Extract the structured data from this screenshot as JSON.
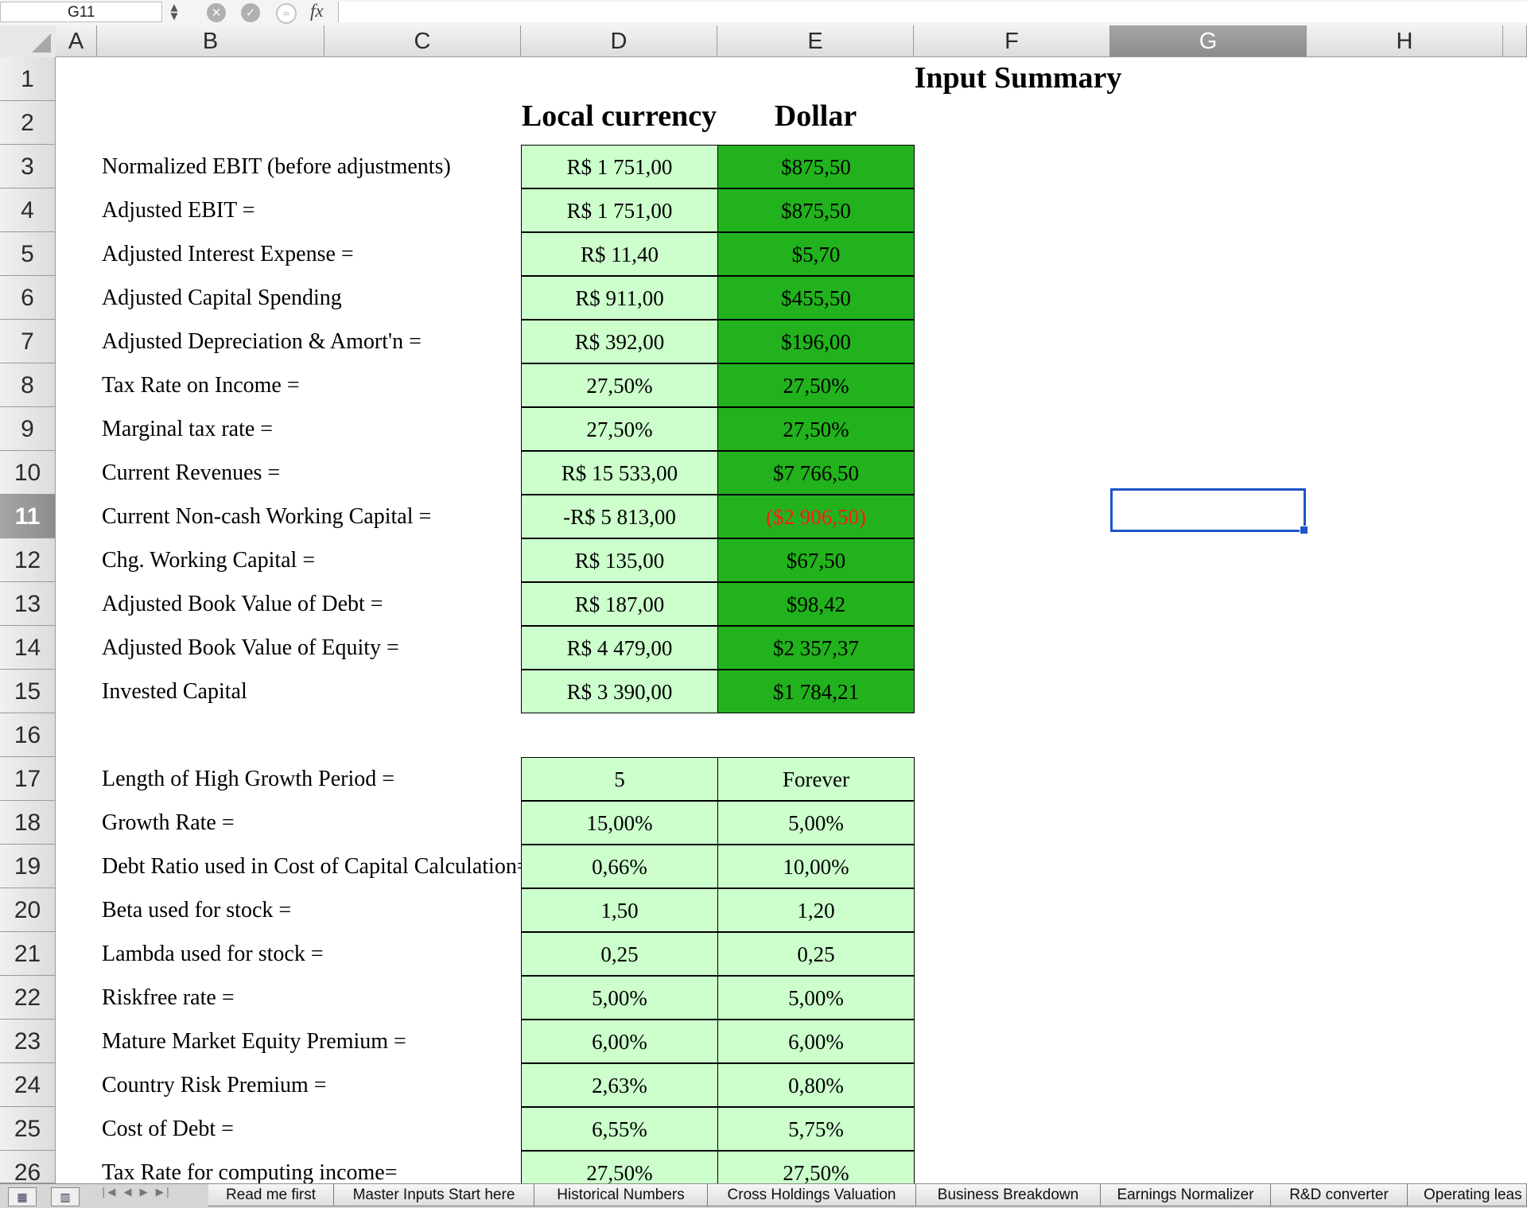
{
  "formula_bar": {
    "name_box": "G11",
    "fx_label": "fx",
    "formula": ""
  },
  "columns": [
    "A",
    "B",
    "C",
    "D",
    "E",
    "F",
    "G",
    "H"
  ],
  "active_column": "G",
  "active_row": "11",
  "rows": [
    "1",
    "2",
    "3",
    "4",
    "5",
    "6",
    "7",
    "8",
    "9",
    "10",
    "11",
    "12",
    "13",
    "14",
    "15",
    "16",
    "17",
    "18",
    "19",
    "20",
    "21",
    "22",
    "23",
    "24",
    "25",
    "26"
  ],
  "sheet": {
    "title": "Input Summary",
    "header_local": "Local currency",
    "header_dollar": "Dollar",
    "block1": [
      {
        "label": "Normalized EBIT (before adjustments)",
        "local": "R$ 1 751,00",
        "dollar": "$875,50"
      },
      {
        "label": "Adjusted EBIT =",
        "local": "R$ 1 751,00",
        "dollar": "$875,50"
      },
      {
        "label": "Adjusted Interest Expense =",
        "local": "R$ 11,40",
        "dollar": "$5,70"
      },
      {
        "label": "Adjusted Capital Spending",
        "local": "R$ 911,00",
        "dollar": "$455,50"
      },
      {
        "label": "Adjusted Depreciation & Amort'n =",
        "local": "R$ 392,00",
        "dollar": "$196,00"
      },
      {
        "label": "Tax Rate on Income =",
        "local": "27,50%",
        "dollar": "27,50%"
      },
      {
        "label": "Marginal tax rate =",
        "local": "27,50%",
        "dollar": "27,50%"
      },
      {
        "label": "Current Revenues =",
        "local": "R$ 15 533,00",
        "dollar": "$7 766,50"
      },
      {
        "label": "Current Non-cash Working Capital =",
        "local": "-R$ 5 813,00",
        "dollar": "($2 906,50)",
        "negative": true
      },
      {
        "label": "Chg. Working Capital =",
        "local": "R$ 135,00",
        "dollar": "$67,50"
      },
      {
        "label": "Adjusted Book Value of Debt =",
        "local": "R$ 187,00",
        "dollar": "$98,42"
      },
      {
        "label": "Adjusted Book Value of Equity =",
        "local": "R$ 4 479,00",
        "dollar": "$2 357,37"
      },
      {
        "label": "Invested Capital",
        "local": "R$ 3 390,00",
        "dollar": "$1 784,21"
      }
    ],
    "block2": [
      {
        "label": "Length of High Growth Period =",
        "local": "5",
        "dollar": "Forever"
      },
      {
        "label": "Growth Rate =",
        "local": "15,00%",
        "dollar": "5,00%"
      },
      {
        "label": "Debt Ratio used in Cost of Capital Calculation=",
        "local": "0,66%",
        "dollar": "10,00%"
      },
      {
        "label": "Beta used for stock =",
        "local": "1,50",
        "dollar": "1,20"
      },
      {
        "label": "Lambda used for stock =",
        "local": "0,25",
        "dollar": "0,25"
      },
      {
        "label": "Riskfree rate =",
        "local": "5,00%",
        "dollar": "5,00%"
      },
      {
        "label": "Mature Market Equity Premium =",
        "local": "6,00%",
        "dollar": "6,00%"
      },
      {
        "label": "Country Risk Premium =",
        "local": "2,63%",
        "dollar": "0,80%"
      },
      {
        "label": "Cost of Debt =",
        "local": "6,55%",
        "dollar": "5,75%"
      },
      {
        "label": "Tax Rate for computing income=",
        "local": "27,50%",
        "dollar": "27,50%"
      }
    ]
  },
  "tabs": [
    "Read me first",
    "Master Inputs Start here",
    "Historical Numbers",
    "Cross Holdings Valuation",
    "Business Breakdown",
    "Earnings Normalizer",
    "R&D converter",
    "Operating leas"
  ],
  "colors": {
    "light_green": "#ccffcc",
    "dark_green": "#22b21d",
    "negative": "#ff1a1a",
    "selection": "#1e55c8"
  }
}
